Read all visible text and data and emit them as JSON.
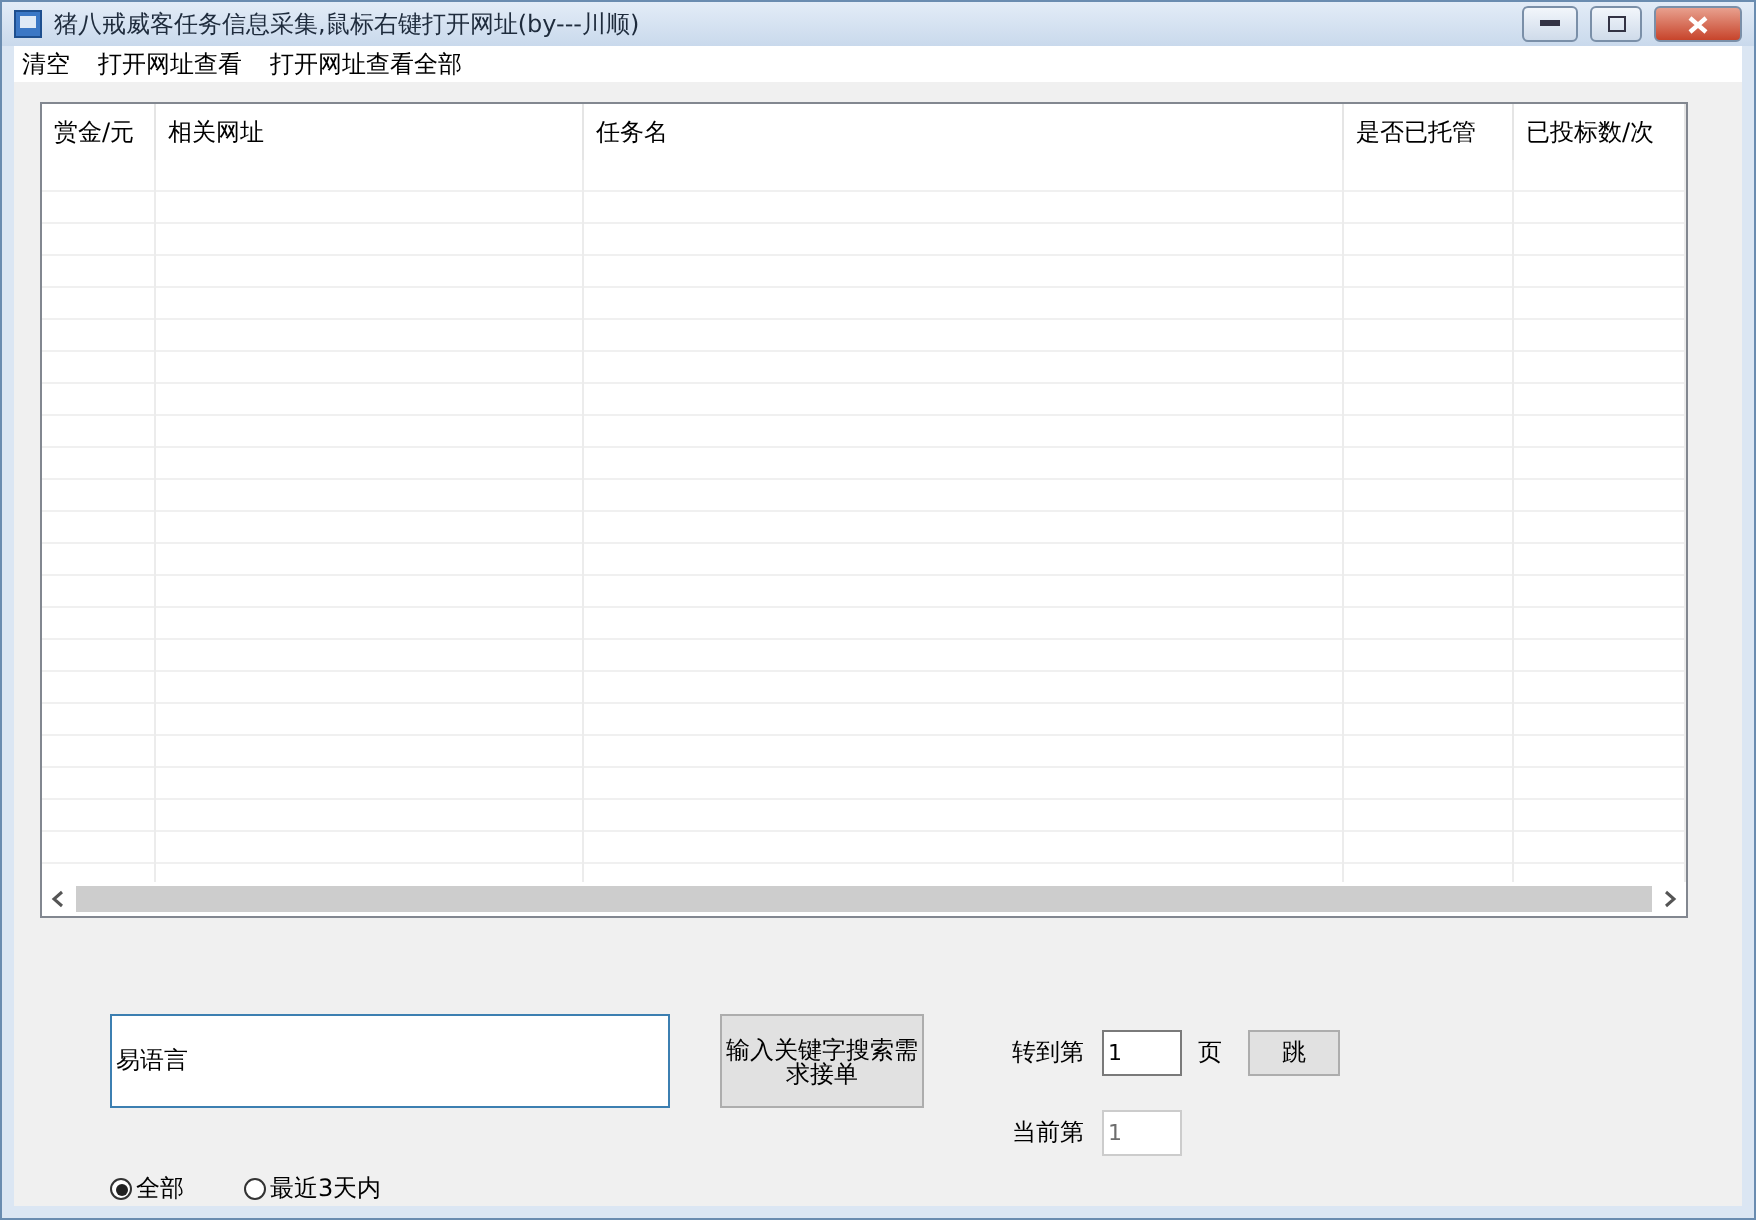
{
  "window": {
    "title": "猪八戒威客任务信息采集,鼠标右键打开网址(by---川顺)"
  },
  "menu": [
    "清空",
    "打开网址查看",
    "打开网址查看全部"
  ],
  "table": {
    "columns": [
      "赏金/元",
      "相关网址",
      "任务名",
      "是否已托管",
      "已投标数/次"
    ]
  },
  "search": {
    "value": "易语言",
    "button": "输入关键字搜索需求接单"
  },
  "goto": {
    "label": "转到第",
    "value": "1",
    "unit": "页",
    "button": "跳"
  },
  "current": {
    "label": "当前第",
    "value": "1",
    "disabled": true
  },
  "filters": [
    {
      "label": "全部",
      "selected": true
    },
    {
      "label": "最近3天内",
      "selected": false
    }
  ]
}
